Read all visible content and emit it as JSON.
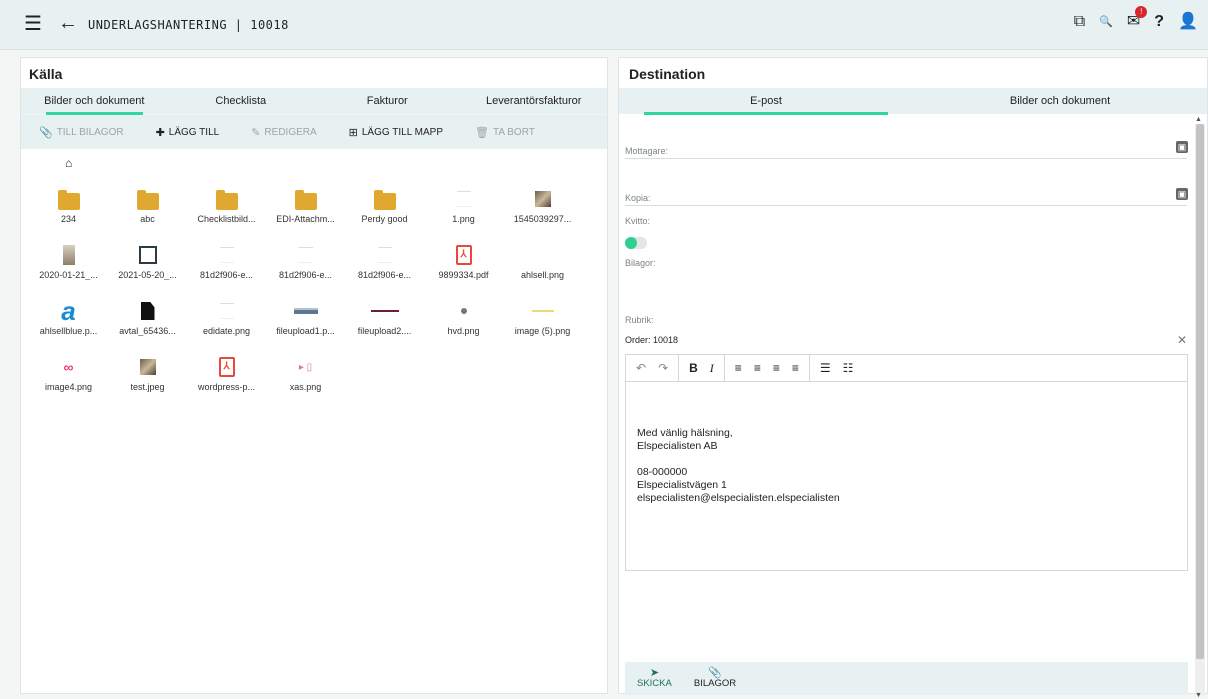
{
  "topbar": {
    "title": "UNDERLAGSHANTERING | 10018",
    "menu_icon": "☰",
    "back_icon": "←",
    "icons": [
      {
        "name": "copy-icon",
        "glyph": "⧉"
      },
      {
        "name": "search-icon",
        "glyph": "🔍"
      },
      {
        "name": "mail-icon",
        "glyph": "✉"
      },
      {
        "name": "help-icon",
        "glyph": "?"
      },
      {
        "name": "user-icon",
        "glyph": "👤"
      }
    ],
    "mail_badge": "!"
  },
  "source": {
    "title": "Källa",
    "tabs": [
      "Bilder och dokument",
      "Checklista",
      "Fakturor",
      "Leverantörsfakturor"
    ],
    "active_tab": 0,
    "toolbar": [
      {
        "label": "TILL BILAGOR",
        "icon": "📎",
        "enabled": false
      },
      {
        "label": "LÄGG TILL",
        "icon": "✚",
        "enabled": true
      },
      {
        "label": "REDIGERA",
        "icon": "✎",
        "enabled": false
      },
      {
        "label": "LÄGG TILL MAPP",
        "icon": "⊞",
        "enabled": true
      },
      {
        "label": "TA BORT",
        "icon": "🗑",
        "enabled": false
      }
    ],
    "home_icon": "⌂",
    "files": [
      {
        "name": "234",
        "kind": "folder"
      },
      {
        "name": "abc",
        "kind": "folder"
      },
      {
        "name": "Checklistbild...",
        "kind": "folder"
      },
      {
        "name": "EDI-Attachm...",
        "kind": "folder"
      },
      {
        "name": "Perdy good",
        "kind": "folder"
      },
      {
        "name": "1.png",
        "kind": "faint"
      },
      {
        "name": "1545039297...",
        "kind": "photo"
      },
      {
        "name": "2020-01-21_...",
        "kind": "photo2"
      },
      {
        "name": "2021-05-20_...",
        "kind": "screen"
      },
      {
        "name": "81d2f906-e...",
        "kind": "faint"
      },
      {
        "name": "81d2f906-e...",
        "kind": "faint"
      },
      {
        "name": "81d2f906-e...",
        "kind": "faint"
      },
      {
        "name": "9899334.pdf",
        "kind": "pdf"
      },
      {
        "name": "ahlsell.png",
        "kind": "blank"
      },
      {
        "name": "ahlsellblue.p...",
        "kind": "bigA"
      },
      {
        "name": "avtal_65436...",
        "kind": "doc"
      },
      {
        "name": "edidate.png",
        "kind": "faint"
      },
      {
        "name": "fileupload1.p...",
        "kind": "bar"
      },
      {
        "name": "fileupload2....",
        "kind": "line"
      },
      {
        "name": "hvd.png",
        "kind": "dot"
      },
      {
        "name": "image (5).png",
        "kind": "yline"
      },
      {
        "name": "image4.png",
        "kind": "infin"
      },
      {
        "name": "test.jpeg",
        "kind": "photo"
      },
      {
        "name": "wordpress-p...",
        "kind": "pdf"
      },
      {
        "name": "xas.png",
        "kind": "xas"
      }
    ]
  },
  "destination": {
    "title": "Destination",
    "tabs": [
      "E-post",
      "Bilder och dokument"
    ],
    "active_tab": 0,
    "recipient_label": "Mottagare:",
    "copy_label": "Kopia:",
    "receipt_label": "Kvitto:",
    "receipt_on": true,
    "attachments_label": "Bilagor:",
    "subject_label": "Rubrik:",
    "subject_value": "Order: 10018",
    "editor_tools": [
      "↶",
      "↷",
      "B",
      "I",
      "≡",
      "≡",
      "≡",
      "≡",
      "☰",
      "☷"
    ],
    "body_lines": [
      "Med vänlig hälsning,",
      "Elspecialisten AB",
      "",
      "08-000000",
      "Elspecialistvägen 1",
      "elspecialisten@elspecialisten.elspecialisten"
    ],
    "send_label": "SKICKA",
    "attachments_button": "BILAGOR"
  }
}
